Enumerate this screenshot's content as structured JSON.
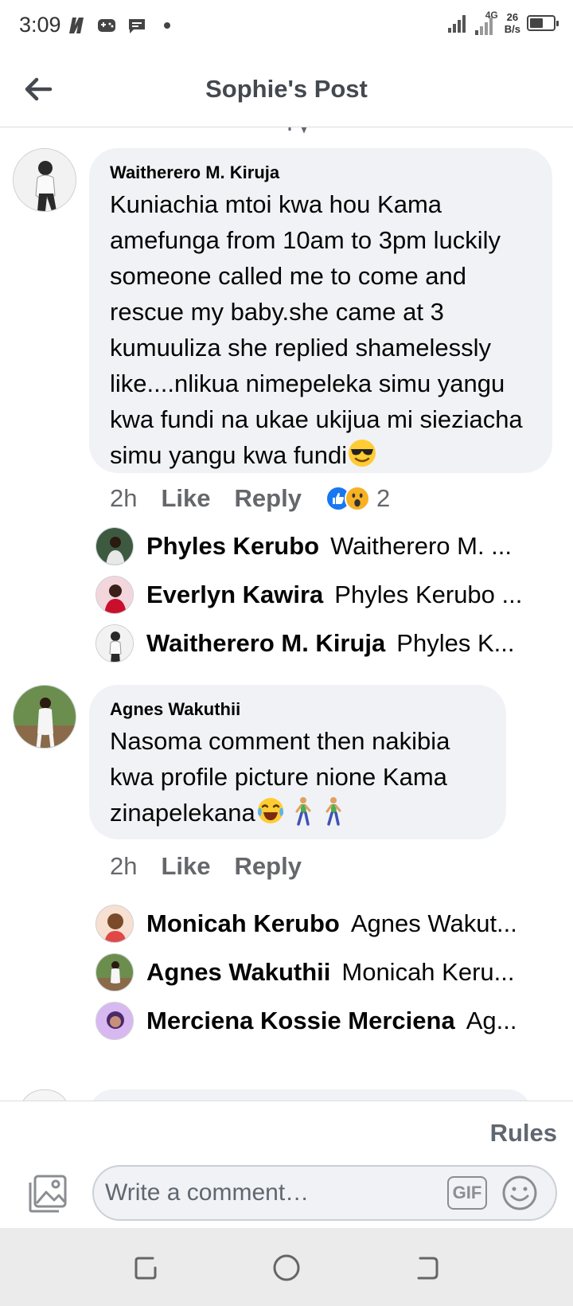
{
  "status_bar": {
    "time": "3:09",
    "network_type": "4G",
    "net_speed_value": "26",
    "net_speed_unit": "B/s"
  },
  "header": {
    "title": "Sophie's Post"
  },
  "comments": [
    {
      "author": "Waitherero M. Kiruja",
      "text": "Kuniachia mtoi kwa hou Kama amefunga from 10am to 3pm luckily someone called me to come and rescue my baby.she came at 3 kumuuliza she replied shamelessly like....nlikua nimepeleka simu yangu kwa fundi na ukae ukijua mi sieziacha simu yangu kwa fundi",
      "emoji": "smiling-face-with-sunglasses",
      "time": "2h",
      "like_label": "Like",
      "reply_label": "Reply",
      "reaction_count": "2",
      "reactions": [
        "like",
        "wow"
      ],
      "replies": [
        {
          "author": "Phyles Kerubo",
          "preview": "Waitherero M. ..."
        },
        {
          "author": "Everlyn Kawira",
          "preview": "Phyles Kerubo ..."
        },
        {
          "author": "Waitherero M. Kiruja",
          "preview": "Phyles K..."
        }
      ]
    },
    {
      "author": "Agnes Wakuthii",
      "text": "Nasoma comment then nakibia kwa profile picture nione Kama zinapelekana",
      "emojis": [
        "face-with-tears-of-joy",
        "person-walking",
        "person-walking"
      ],
      "time": "2h",
      "like_label": "Like",
      "reply_label": "Reply",
      "replies": [
        {
          "author": "Monicah Kerubo",
          "preview": "Agnes Wakut..."
        },
        {
          "author": "Agnes Wakuthii",
          "preview": "Monicah Keru..."
        },
        {
          "author": "Merciena Kossie Merciena",
          "preview": "Ag..."
        }
      ]
    }
  ],
  "composer": {
    "rules_label": "Rules",
    "placeholder": "Write a comment…",
    "gif_label": "GIF"
  },
  "colors": {
    "bubble": "#f0f2f5",
    "secondary_text": "#65676b",
    "like_blue": "#1877f2",
    "wow_yellow": "#f7b125",
    "nav_bar": "#ebebeb"
  }
}
